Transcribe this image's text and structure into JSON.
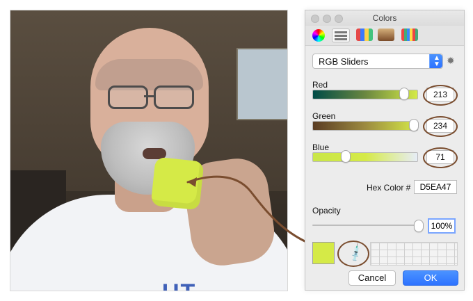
{
  "window": {
    "title": "Colors"
  },
  "panel": {
    "mode_select_value": "RGB Sliders",
    "labels": {
      "red": "Red",
      "green": "Green",
      "blue": "Blue",
      "hex": "Hex Color #",
      "opacity": "Opacity"
    },
    "values": {
      "red": "213",
      "green": "234",
      "blue": "71",
      "hex": "D5EA47",
      "opacity": "100%"
    },
    "buttons": {
      "cancel": "Cancel",
      "ok": "OK"
    }
  },
  "photo": {
    "shirt_text": "UT"
  },
  "colors": {
    "selected": "#D5EA47",
    "accent_blue": "#2D72FF",
    "annotation_brown": "#7A4D2F"
  },
  "icons": {
    "toolbar": [
      "color-wheel-icon",
      "sliders-icon",
      "palettes-icon",
      "image-palettes-icon",
      "pencils-icon"
    ],
    "gear": "gear-icon",
    "eyedropper": "eyedropper-icon"
  }
}
